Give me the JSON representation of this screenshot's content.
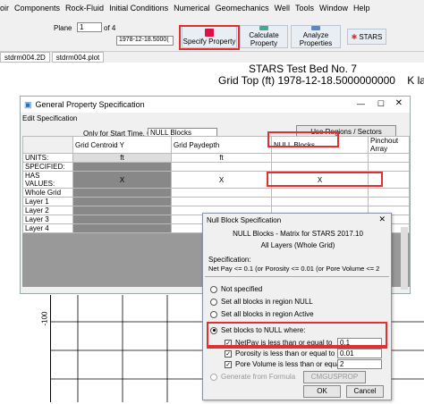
{
  "menu": [
    "oir",
    "Components",
    "Rock-Fluid",
    "Initial Conditions",
    "Numerical",
    "Geomechanics",
    "Well",
    "Tools",
    "Window",
    "Help"
  ],
  "toolbar": {
    "plane_label": "Plane",
    "plane_value": "1",
    "of_label": "of 4",
    "date_value": "1978-12-18.5000(",
    "specify_property": "Specify Property",
    "calculate_property": "Calculate Property",
    "analyze_properties": "Analyze Properties",
    "stars_label": "STARS"
  },
  "tabs": [
    "stdrm004.2D",
    "stdrm004.plot"
  ],
  "plot": {
    "title": "STARS Test Bed No. 7",
    "subtitle_prefix": "Grid Top (ft) 1978-12-18.5000000000",
    "subtitle_suffix": "K layer",
    "axis_tick": "-100"
  },
  "property_window": {
    "title": "General Property Specification",
    "menu_edit": "Edit Specification",
    "start_time_label": "Only for Start Time, Go to",
    "goto_value": "NULL Blocks",
    "regions_button": "Use Regions / Sectors",
    "columns": [
      "Grid Centroid Y",
      "Grid Paydepth",
      "NULL Blocks",
      "Pinchout Array"
    ],
    "row_labels": [
      "UNITS:",
      "SPECIFIED:",
      "HAS VALUES:",
      "Whole Grid",
      "Layer 1",
      "Layer 2",
      "Layer 3",
      "Layer 4"
    ],
    "units": [
      "ft",
      "ft",
      "",
      ""
    ],
    "has_values": [
      "X",
      "X",
      "X",
      ""
    ]
  },
  "null_dialog": {
    "title": "Null Block Specification",
    "header_line1": "NULL Blocks - Matrix for STARS 2017.10",
    "header_line2": "All Layers (Whole Grid)",
    "spec_label": "Specification:",
    "spec_value": "Net Pay <= 0.1 (or Porosity <= 0.01 (or Pore Volume <= 2",
    "opt_not_specified": "Not specified",
    "opt_region_null": "Set all blocks in region NULL",
    "opt_region_active": "Set all blocks in region Active",
    "opt_null_where": "Set blocks to NULL where:",
    "cond_netpay": "NetPay is less than or equal to",
    "cond_porosity": "Porosity is less than or equal to",
    "cond_porevol": "Pore Volume is less than or equal to",
    "val_netpay": "0.1",
    "val_porosity": "0.01",
    "val_porevol": "2",
    "opt_formula": "Generate from Formula",
    "cmg_button": "CMGUSPROP",
    "ok": "OK",
    "cancel": "Cancel"
  },
  "colors": {
    "highlight": "#e03030",
    "dialog_bg": "#f0f0f0",
    "null_gray": "#888888"
  }
}
